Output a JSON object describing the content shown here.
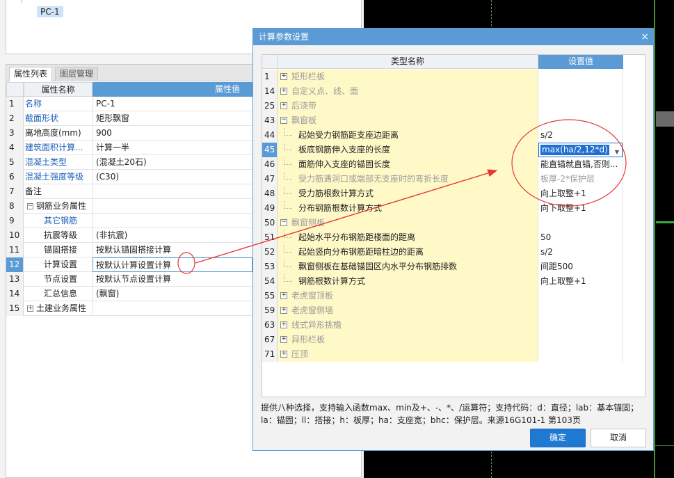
{
  "tree": {
    "selected_item": "PC-1"
  },
  "left_panel": {
    "tabs": [
      {
        "label": "属性列表"
      },
      {
        "label": "图层管理"
      }
    ],
    "header": {
      "name": "属性名称",
      "value": "属性值"
    },
    "rows": [
      {
        "num": "1",
        "name": "名称",
        "value": "PC-1"
      },
      {
        "num": "2",
        "name": "截面形状",
        "value": "矩形飘窗"
      },
      {
        "num": "3",
        "name": "离地高度(mm)",
        "value": "900"
      },
      {
        "num": "4",
        "name": "建筑面积计算...",
        "value": "计算一半"
      },
      {
        "num": "5",
        "name": "混凝土类型",
        "value": "(混凝土20石)"
      },
      {
        "num": "6",
        "name": "混凝土强度等级",
        "value": "(C30)"
      },
      {
        "num": "7",
        "name": "备注",
        "value": ""
      },
      {
        "num": "8",
        "name": "钢筋业务属性",
        "value": "",
        "toggle": "−"
      },
      {
        "num": "9",
        "name": "其它钢筋",
        "value": ""
      },
      {
        "num": "10",
        "name": "抗震等级",
        "value": "(非抗震)"
      },
      {
        "num": "11",
        "name": "锚固搭接",
        "value": "按默认锚固搭接计算"
      },
      {
        "num": "12",
        "name": "计算设置",
        "value": "按默认计算设置计算"
      },
      {
        "num": "13",
        "name": "节点设置",
        "value": "按默认节点设置计算"
      },
      {
        "num": "14",
        "name": "汇总信息",
        "value": "(飘窗)"
      },
      {
        "num": "15",
        "name": "土建业务属性",
        "value": "",
        "toggle": "+"
      }
    ]
  },
  "dialog": {
    "title": "计算参数设置",
    "close_icon": "×",
    "columns": {
      "name": "类型名称",
      "value": "设置值"
    },
    "rows": [
      {
        "num": "1",
        "name": "矩形栏板",
        "value": "",
        "toggle": "+"
      },
      {
        "num": "14",
        "name": "自定义点、线、面",
        "value": "",
        "toggle": "+"
      },
      {
        "num": "25",
        "name": "后浇带",
        "value": "",
        "toggle": "+"
      },
      {
        "num": "43",
        "name": "飘窗板",
        "value": "",
        "toggle": "−"
      },
      {
        "num": "44",
        "name": "起始受力钢筋距支座边距离",
        "value": "s/2"
      },
      {
        "num": "45",
        "name": "板底钢筋伸入支座的长度",
        "value": "max(ha/2,12*d)"
      },
      {
        "num": "46",
        "name": "面筋伸入支座的锚固长度",
        "value": "能直锚就直锚,否则..."
      },
      {
        "num": "47",
        "name": "受力筋遇洞口或端部无支座时的弯折长度",
        "value": "板厚-2*保护层"
      },
      {
        "num": "48",
        "name": "受力筋根数计算方式",
        "value": "向上取整+1"
      },
      {
        "num": "49",
        "name": "分布钢筋根数计算方式",
        "value": "向下取整+1"
      },
      {
        "num": "50",
        "name": "飘窗侧板",
        "value": "",
        "toggle": "−"
      },
      {
        "num": "51",
        "name": "起始水平分布钢筋距楼面的距离",
        "value": "50"
      },
      {
        "num": "52",
        "name": "起始竖向分布钢筋距暗柱边的距离",
        "value": "s/2"
      },
      {
        "num": "53",
        "name": "飘窗侧板在基础锚固区内水平分布钢筋排数",
        "value": "间距500"
      },
      {
        "num": "54",
        "name": "钢筋根数计算方式",
        "value": "向上取整+1"
      },
      {
        "num": "55",
        "name": "老虎窗顶板",
        "value": "",
        "toggle": "+"
      },
      {
        "num": "59",
        "name": "老虎窗侧墙",
        "value": "",
        "toggle": "+"
      },
      {
        "num": "63",
        "name": "线式异形挑檐",
        "value": "",
        "toggle": "+"
      },
      {
        "num": "67",
        "name": "异形栏板",
        "value": "",
        "toggle": "+"
      },
      {
        "num": "71",
        "name": "压顶",
        "value": "",
        "toggle": "+"
      }
    ],
    "help_text": "提供八种选择，支持输入函数max、min及+、-、*、/运算符；支持代码：d：直径；lab：基本锚固；la：锚固；ll：搭接；h：板厚；ha：支座宽；bhc：保护层。来源16G101-1 第103页",
    "ok_label": "确定",
    "cancel_label": "取消"
  },
  "colors": {
    "accent": "#5b9bd5",
    "annotation": "#e53935",
    "name_cell_bg": "#fff9c8"
  }
}
